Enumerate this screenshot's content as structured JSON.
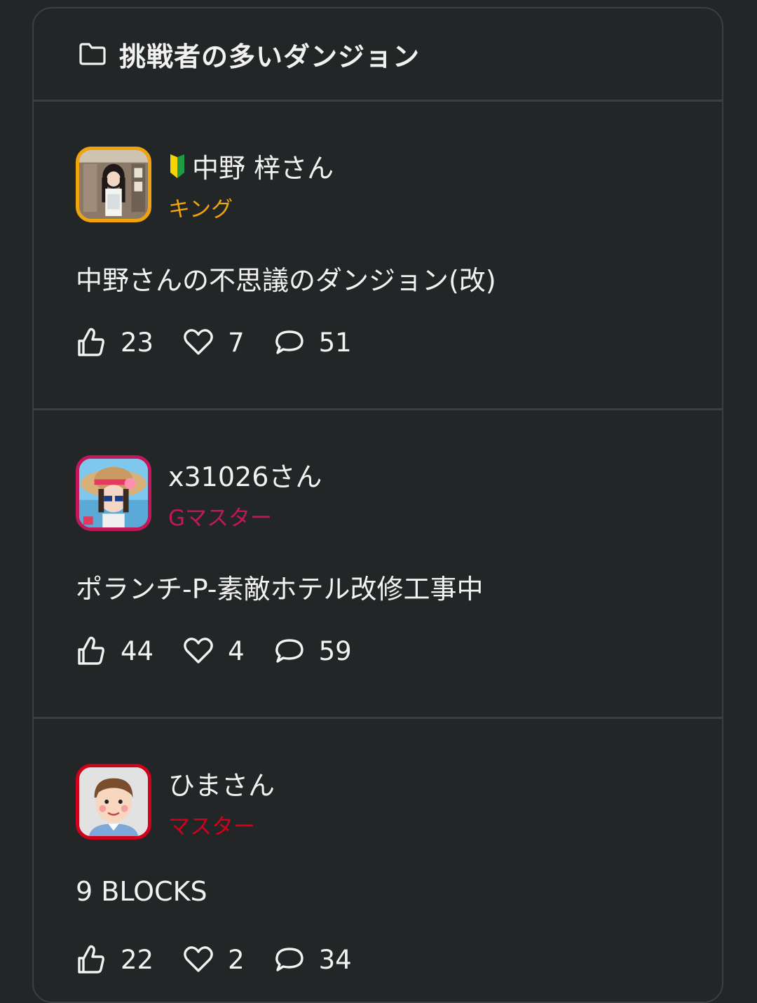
{
  "section": {
    "title": "挑戦者の多いダンジョン",
    "icon": "folder-icon"
  },
  "entries": [
    {
      "user_name": "中野 梓さん",
      "beginner_mark": true,
      "rank": "キング",
      "rank_color": "#f0a30a",
      "avatar_border": "#f0a30a",
      "dungeon_title": "中野さんの不思議のダンジョン(改)",
      "likes": "23",
      "favorites": "7",
      "comments": "51"
    },
    {
      "user_name": "x31026さん",
      "beginner_mark": false,
      "rank": "Gマスター",
      "rank_color": "#c2185b",
      "avatar_border": "#c2185b",
      "dungeon_title": "ポランチ-P-素敵ホテル改修工事中",
      "likes": "44",
      "favorites": "4",
      "comments": "59"
    },
    {
      "user_name": "ひまさん",
      "beginner_mark": false,
      "rank": "マスター",
      "rank_color": "#d0021b",
      "avatar_border": "#d0021b",
      "dungeon_title": "9 BLOCKS",
      "likes": "22",
      "favorites": "2",
      "comments": "34"
    }
  ],
  "icons": {
    "like": "thumbs-up-icon",
    "favorite": "heart-icon",
    "comment": "speech-bubble-icon"
  }
}
